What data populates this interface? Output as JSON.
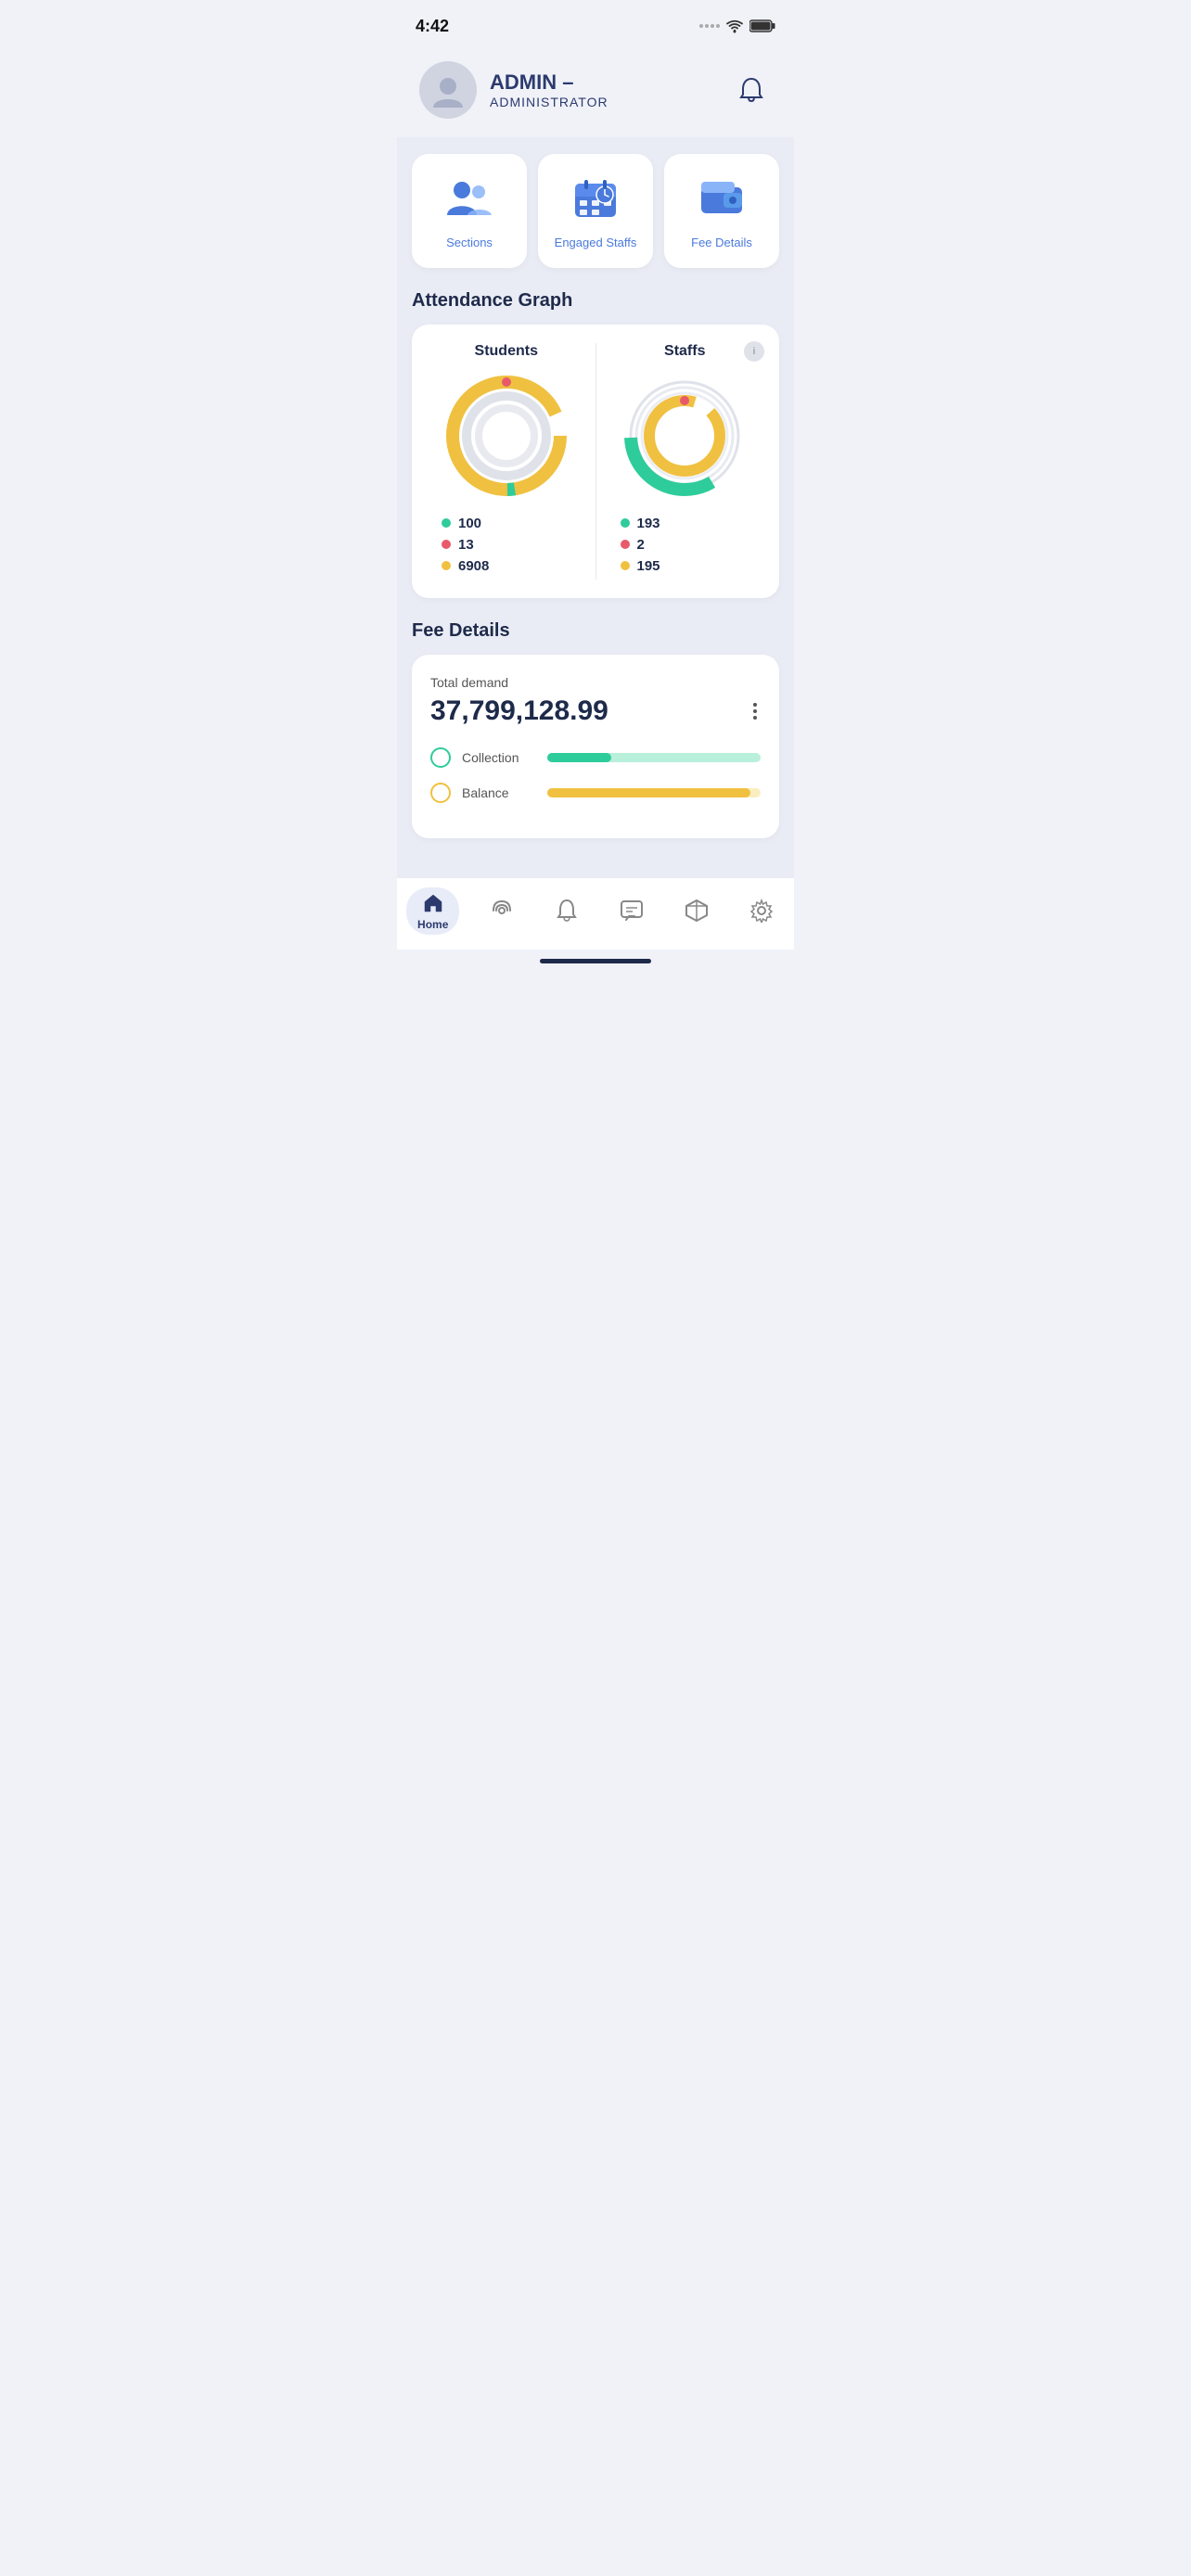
{
  "statusBar": {
    "time": "4:42"
  },
  "header": {
    "adminName": "ADMIN –",
    "adminRole": "ADMINISTRATOR"
  },
  "quickActions": [
    {
      "id": "sections",
      "label": "Sections"
    },
    {
      "id": "engaged-staffs",
      "label": "Engaged Staffs"
    },
    {
      "id": "fee-details-card",
      "label": "Fee Details"
    }
  ],
  "attendanceGraph": {
    "title": "Attendance Graph",
    "students": {
      "title": "Students",
      "legend": [
        {
          "color": "#2ecc9a",
          "value": "100"
        },
        {
          "color": "#e85a6a",
          "value": "13"
        },
        {
          "color": "#f0c040",
          "value": "6908"
        }
      ]
    },
    "staffs": {
      "title": "Staffs",
      "legend": [
        {
          "color": "#2ecc9a",
          "value": "193"
        },
        {
          "color": "#e85a6a",
          "value": "2"
        },
        {
          "color": "#f0c040",
          "value": "195"
        }
      ]
    }
  },
  "feeDetails": {
    "sectionTitle": "Fee Details",
    "totalDemandLabel": "Total demand",
    "totalDemandValue": "37,799,128.99",
    "collectionLabel": "Collection",
    "collectionProgress": 30,
    "balanceLabel": "Balance",
    "balanceProgress": 95
  },
  "bottomNav": [
    {
      "id": "home",
      "label": "Home",
      "active": true
    },
    {
      "id": "broadcast",
      "label": "",
      "active": false
    },
    {
      "id": "notifications",
      "label": "",
      "active": false
    },
    {
      "id": "messages",
      "label": "",
      "active": false
    },
    {
      "id": "inventory",
      "label": "",
      "active": false
    },
    {
      "id": "settings",
      "label": "",
      "active": false
    }
  ]
}
